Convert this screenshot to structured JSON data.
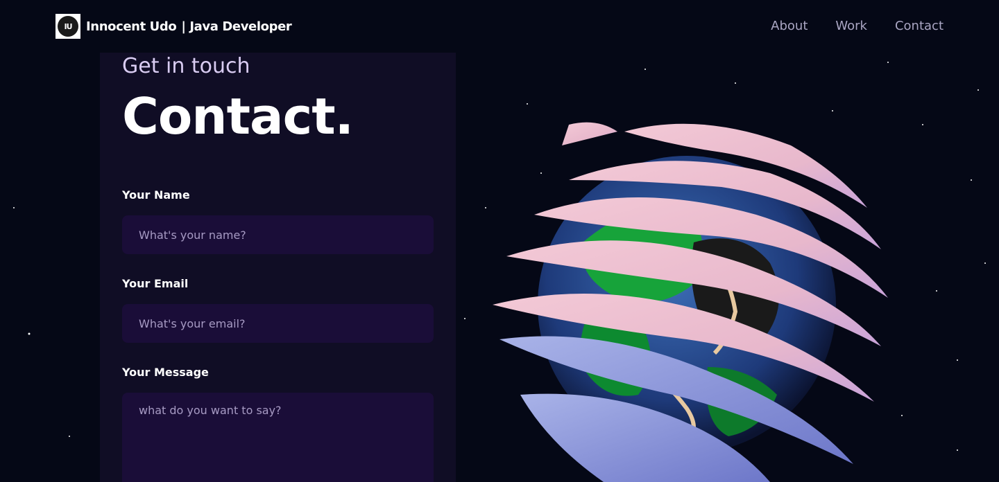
{
  "nav": {
    "logo_text": "IU",
    "brand_name": "Innocent Udo",
    "brand_role": "| Java Developer",
    "links": [
      "About",
      "Work",
      "Contact"
    ]
  },
  "contact": {
    "subtitle": "Get in touch",
    "title": "Contact.",
    "fields": {
      "name": {
        "label": "Your Name",
        "placeholder": "What's your name?"
      },
      "email": {
        "label": "Your Email",
        "placeholder": "What's your email?"
      },
      "message": {
        "label": "Your Message",
        "placeholder": "what do you want to say?"
      }
    }
  },
  "colors": {
    "background": "#050816",
    "card": "#100d25",
    "input": "#1a0d38",
    "nav_link": "#aaa6c3",
    "subtitle": "#d9ccf2"
  },
  "icons": {
    "logo": "logo-icon",
    "globe": "earth-globe-3d-icon"
  }
}
